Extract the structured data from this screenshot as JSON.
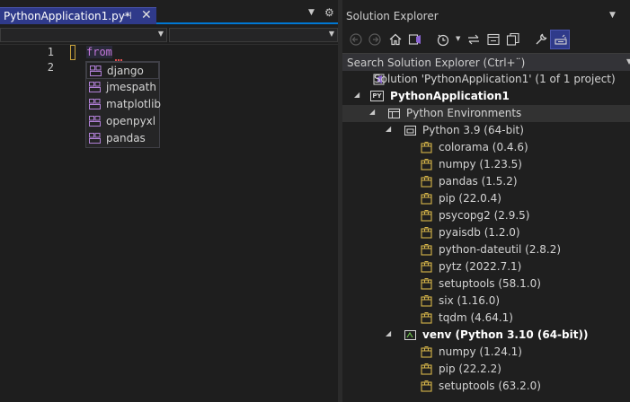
{
  "editor": {
    "tab_title": "PythonApplication1.py*",
    "pin_glyph": "⊣",
    "close_glyph": "✕",
    "lines": [
      {
        "number": "1",
        "text": "from"
      },
      {
        "number": "2",
        "text": ""
      }
    ],
    "completion": [
      "django",
      "jmespath",
      "matplotlib",
      "openpyxl",
      "pandas"
    ]
  },
  "solution_explorer": {
    "title": "Solution Explorer",
    "search_placeholder": "Search Solution Explorer (Ctrl+¨)",
    "tree": {
      "solution": "Solution 'PythonApplication1' (1 of 1 project)",
      "project": "PythonApplication1",
      "environments": "Python Environments",
      "env1": "Python 3.9 (64-bit)",
      "env1_packages": [
        "colorama (0.4.6)",
        "numpy (1.23.5)",
        "pandas (1.5.2)",
        "pip (22.0.4)",
        "psycopg2 (2.9.5)",
        "pyaisdb (1.2.0)",
        "python-dateutil (2.8.2)",
        "pytz (2022.7.1)",
        "setuptools (58.1.0)",
        "six (1.16.0)",
        "tqdm (4.64.1)"
      ],
      "env2": "venv (Python 3.10 (64-bit))",
      "env2_packages": [
        "numpy (1.24.1)",
        "pip (22.2.2)",
        "setuptools (63.2.0)"
      ]
    }
  },
  "colors": {
    "accent": "#0078d4",
    "tab_active": "#2f3a8a",
    "keyword": "#c678dd",
    "package_icon": "#d7b64a",
    "completion_icon": "#b180d7"
  },
  "icons": {
    "toolbar": [
      "back-icon",
      "forward-icon",
      "home-icon",
      "vs-switch-views-icon",
      "pending-changes-filter-icon",
      "sync-icon",
      "collapse-all-icon",
      "show-all-files-icon",
      "properties-icon",
      "preview-selected-icon"
    ]
  }
}
